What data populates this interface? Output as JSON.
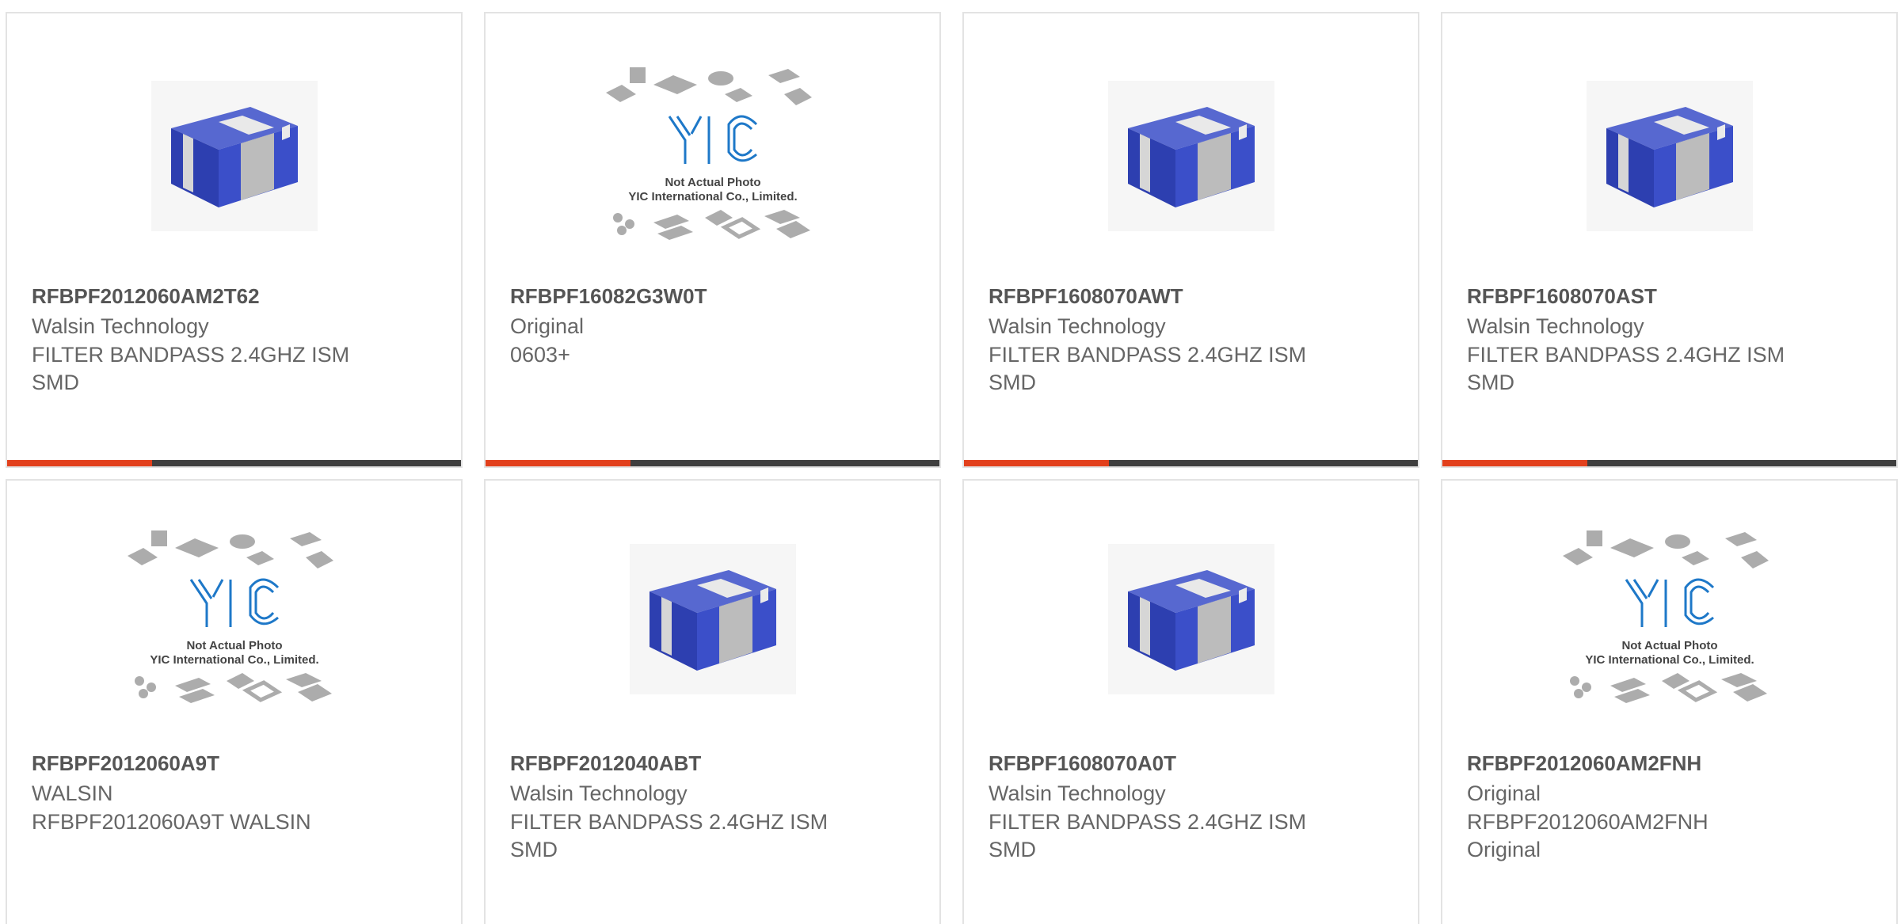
{
  "colors": {
    "accent": "#e2401c",
    "track": "#3f3f3f",
    "title_text": "#555555",
    "body_text": "#666666",
    "chip_blue": "#3b4fc9",
    "logo_blue": "#1e78c8"
  },
  "placeholder": {
    "line1": "Not Actual Photo",
    "line2": "YIC International Co., Limited."
  },
  "products": [
    {
      "image": "chip-photo",
      "part_number": "RFBPF2012060AM2T62",
      "manufacturer": "Walsin Technology",
      "description": "FILTER BANDPASS 2.4GHZ ISM",
      "extra": "SMD",
      "progress": 0.32
    },
    {
      "image": "placeholder-photo",
      "part_number": "RFBPF16082G3W0T",
      "manufacturer": "Original",
      "description": "0603+",
      "extra": "",
      "progress": 0.32
    },
    {
      "image": "chip-photo",
      "part_number": "RFBPF1608070AWT",
      "manufacturer": "Walsin Technology",
      "description": "FILTER BANDPASS 2.4GHZ ISM",
      "extra": "SMD",
      "progress": 0.32
    },
    {
      "image": "chip-photo",
      "part_number": "RFBPF1608070AST",
      "manufacturer": "Walsin Technology",
      "description": "FILTER BANDPASS 2.4GHZ ISM",
      "extra": "SMD",
      "progress": 0.32
    },
    {
      "image": "placeholder-photo",
      "part_number": "RFBPF2012060A9T",
      "manufacturer": "WALSIN",
      "description": "RFBPF2012060A9T WALSIN",
      "extra": ""
    },
    {
      "image": "chip-photo",
      "part_number": "RFBPF2012040ABT",
      "manufacturer": "Walsin Technology",
      "description": "FILTER BANDPASS 2.4GHZ ISM",
      "extra": "SMD"
    },
    {
      "image": "chip-photo",
      "part_number": "RFBPF1608070A0T",
      "manufacturer": "Walsin Technology",
      "description": "FILTER BANDPASS 2.4GHZ ISM",
      "extra": "SMD"
    },
    {
      "image": "placeholder-photo",
      "part_number": "RFBPF2012060AM2FNH",
      "manufacturer": "Original",
      "description": "RFBPF2012060AM2FNH",
      "extra": "Original"
    }
  ]
}
